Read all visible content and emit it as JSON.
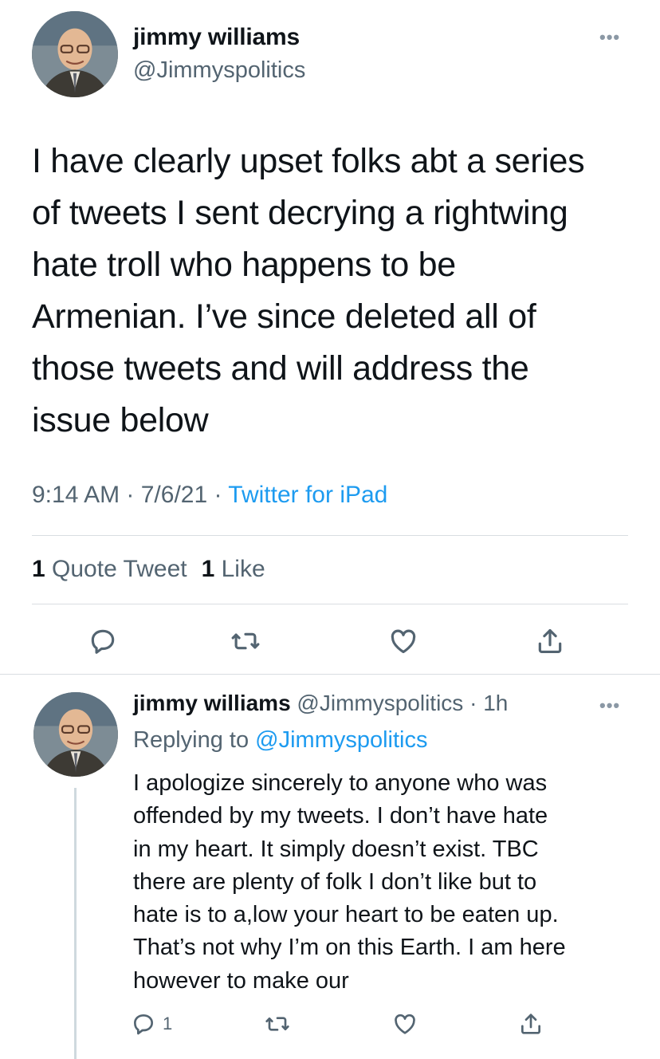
{
  "tweet": {
    "name": "jimmy williams",
    "handle": "@Jimmyspolitics",
    "more_icon": "more-horizontal-icon",
    "text": "I have clearly upset folks abt a series\nof tweets I sent decrying a rightwing\nhate troll who happens to be\nArmenian. I’ve since deleted all of\nthose tweets and will address the\nissue below",
    "time": "9:14 AM",
    "separator": " · ",
    "date": "7/6/21",
    "source": "Twitter for iPad",
    "stats": {
      "quote_count": "1",
      "quote_label": "Quote Tweet",
      "like_count": "1",
      "like_label": "Like"
    },
    "actions": [
      "reply-icon",
      "retweet-icon",
      "like-icon",
      "share-icon"
    ]
  },
  "reply": {
    "name": "jimmy williams",
    "handle": "@Jimmyspolitics",
    "time_sep": " · ",
    "time": "1h",
    "replying_label": "Replying to ",
    "replying_to": "@Jimmyspolitics",
    "text": "I apologize sincerely to anyone who was\noffended by my tweets. I don’t have hate\nin my heart. It simply doesn’t exist. TBC\nthere are plenty of folk I don’t like but to\nhate is to a,low your heart to be eaten up.\nThat’s not why I’m on this Earth. I am here\nhowever to make our",
    "reply_count": "1"
  },
  "colors": {
    "text": "#0f1419",
    "secondary": "#536471",
    "accent": "#1d9bf0",
    "divider": "#d9dde1"
  }
}
